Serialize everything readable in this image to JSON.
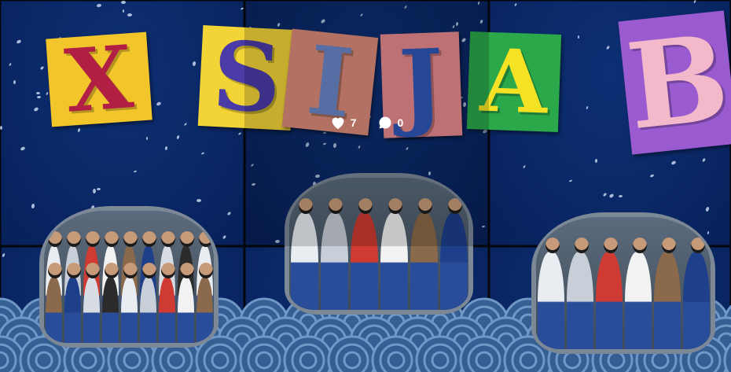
{
  "letters": [
    {
      "char": "X",
      "bg": "#f2c52b",
      "fg": "#b21f44"
    },
    {
      "char": "S",
      "bg": "#f2d437",
      "fg": "#4a3ba6"
    },
    {
      "char": "I",
      "bg": "#d98a78",
      "fg": "#6a87c7"
    },
    {
      "char": "J",
      "bg": "#e88a8f",
      "fg": "#2f57b8"
    },
    {
      "char": "A",
      "bg": "#2aa84a",
      "fg": "#f5e224"
    },
    {
      "char": "B",
      "bg": "#9a5bd0",
      "fg": "#f3b8c9"
    }
  ],
  "post_overlay": {
    "likes": "7",
    "comments": "0"
  },
  "colors": {
    "background": "#0a2866",
    "wave_pattern": "#3e6ea3",
    "sticker_border": "#7c8896"
  },
  "icons": {
    "likes": "heart-icon",
    "comments": "comment-bubble-icon"
  }
}
